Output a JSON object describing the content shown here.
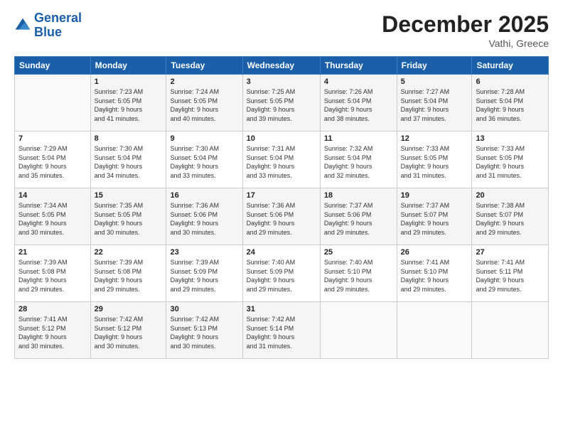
{
  "header": {
    "logo_line1": "General",
    "logo_line2": "Blue",
    "month": "December 2025",
    "location": "Vathi, Greece"
  },
  "days_of_week": [
    "Sunday",
    "Monday",
    "Tuesday",
    "Wednesday",
    "Thursday",
    "Friday",
    "Saturday"
  ],
  "weeks": [
    [
      {
        "num": "",
        "info": ""
      },
      {
        "num": "1",
        "info": "Sunrise: 7:23 AM\nSunset: 5:05 PM\nDaylight: 9 hours\nand 41 minutes."
      },
      {
        "num": "2",
        "info": "Sunrise: 7:24 AM\nSunset: 5:05 PM\nDaylight: 9 hours\nand 40 minutes."
      },
      {
        "num": "3",
        "info": "Sunrise: 7:25 AM\nSunset: 5:05 PM\nDaylight: 9 hours\nand 39 minutes."
      },
      {
        "num": "4",
        "info": "Sunrise: 7:26 AM\nSunset: 5:04 PM\nDaylight: 9 hours\nand 38 minutes."
      },
      {
        "num": "5",
        "info": "Sunrise: 7:27 AM\nSunset: 5:04 PM\nDaylight: 9 hours\nand 37 minutes."
      },
      {
        "num": "6",
        "info": "Sunrise: 7:28 AM\nSunset: 5:04 PM\nDaylight: 9 hours\nand 36 minutes."
      }
    ],
    [
      {
        "num": "7",
        "info": "Sunrise: 7:29 AM\nSunset: 5:04 PM\nDaylight: 9 hours\nand 35 minutes."
      },
      {
        "num": "8",
        "info": "Sunrise: 7:30 AM\nSunset: 5:04 PM\nDaylight: 9 hours\nand 34 minutes."
      },
      {
        "num": "9",
        "info": "Sunrise: 7:30 AM\nSunset: 5:04 PM\nDaylight: 9 hours\nand 33 minutes."
      },
      {
        "num": "10",
        "info": "Sunrise: 7:31 AM\nSunset: 5:04 PM\nDaylight: 9 hours\nand 33 minutes."
      },
      {
        "num": "11",
        "info": "Sunrise: 7:32 AM\nSunset: 5:04 PM\nDaylight: 9 hours\nand 32 minutes."
      },
      {
        "num": "12",
        "info": "Sunrise: 7:33 AM\nSunset: 5:05 PM\nDaylight: 9 hours\nand 31 minutes."
      },
      {
        "num": "13",
        "info": "Sunrise: 7:33 AM\nSunset: 5:05 PM\nDaylight: 9 hours\nand 31 minutes."
      }
    ],
    [
      {
        "num": "14",
        "info": "Sunrise: 7:34 AM\nSunset: 5:05 PM\nDaylight: 9 hours\nand 30 minutes."
      },
      {
        "num": "15",
        "info": "Sunrise: 7:35 AM\nSunset: 5:05 PM\nDaylight: 9 hours\nand 30 minutes."
      },
      {
        "num": "16",
        "info": "Sunrise: 7:36 AM\nSunset: 5:06 PM\nDaylight: 9 hours\nand 30 minutes."
      },
      {
        "num": "17",
        "info": "Sunrise: 7:36 AM\nSunset: 5:06 PM\nDaylight: 9 hours\nand 29 minutes."
      },
      {
        "num": "18",
        "info": "Sunrise: 7:37 AM\nSunset: 5:06 PM\nDaylight: 9 hours\nand 29 minutes."
      },
      {
        "num": "19",
        "info": "Sunrise: 7:37 AM\nSunset: 5:07 PM\nDaylight: 9 hours\nand 29 minutes."
      },
      {
        "num": "20",
        "info": "Sunrise: 7:38 AM\nSunset: 5:07 PM\nDaylight: 9 hours\nand 29 minutes."
      }
    ],
    [
      {
        "num": "21",
        "info": "Sunrise: 7:39 AM\nSunset: 5:08 PM\nDaylight: 9 hours\nand 29 minutes."
      },
      {
        "num": "22",
        "info": "Sunrise: 7:39 AM\nSunset: 5:08 PM\nDaylight: 9 hours\nand 29 minutes."
      },
      {
        "num": "23",
        "info": "Sunrise: 7:39 AM\nSunset: 5:09 PM\nDaylight: 9 hours\nand 29 minutes."
      },
      {
        "num": "24",
        "info": "Sunrise: 7:40 AM\nSunset: 5:09 PM\nDaylight: 9 hours\nand 29 minutes."
      },
      {
        "num": "25",
        "info": "Sunrise: 7:40 AM\nSunset: 5:10 PM\nDaylight: 9 hours\nand 29 minutes."
      },
      {
        "num": "26",
        "info": "Sunrise: 7:41 AM\nSunset: 5:10 PM\nDaylight: 9 hours\nand 29 minutes."
      },
      {
        "num": "27",
        "info": "Sunrise: 7:41 AM\nSunset: 5:11 PM\nDaylight: 9 hours\nand 29 minutes."
      }
    ],
    [
      {
        "num": "28",
        "info": "Sunrise: 7:41 AM\nSunset: 5:12 PM\nDaylight: 9 hours\nand 30 minutes."
      },
      {
        "num": "29",
        "info": "Sunrise: 7:42 AM\nSunset: 5:12 PM\nDaylight: 9 hours\nand 30 minutes."
      },
      {
        "num": "30",
        "info": "Sunrise: 7:42 AM\nSunset: 5:13 PM\nDaylight: 9 hours\nand 30 minutes."
      },
      {
        "num": "31",
        "info": "Sunrise: 7:42 AM\nSunset: 5:14 PM\nDaylight: 9 hours\nand 31 minutes."
      },
      {
        "num": "",
        "info": ""
      },
      {
        "num": "",
        "info": ""
      },
      {
        "num": "",
        "info": ""
      }
    ]
  ]
}
